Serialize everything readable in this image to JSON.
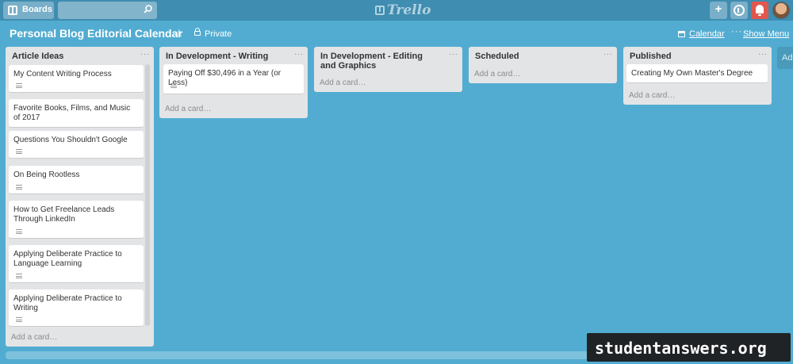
{
  "header": {
    "boards_label": "Boards",
    "search_placeholder": "",
    "logo_text": "Trello",
    "icons": [
      "boards-icon",
      "search-icon",
      "plus-icon",
      "info-icon",
      "bell-icon"
    ]
  },
  "board": {
    "title": "Personal Blog Editorial Calendar",
    "visibility": "Private",
    "calendar_label": "Calendar",
    "show_menu_label": "Show Menu",
    "add_list_label": "Ad"
  },
  "lists": [
    {
      "title": "Article Ideas",
      "add_card": "Add a card…",
      "cards": [
        {
          "title": "My Content Writing Process"
        },
        {
          "title": "Favorite Books, Films, and Music of 2017"
        },
        {
          "title": "Questions You Shouldn't Google"
        },
        {
          "title": "On Being Rootless"
        },
        {
          "title": "How to Get Freelance Leads Through LinkedIn"
        },
        {
          "title": "Applying Deliberate Practice to Language Learning"
        },
        {
          "title": "Applying Deliberate Practice to Writing"
        }
      ]
    },
    {
      "title": "In Development - Writing",
      "add_card": "Add a card…",
      "cards": [
        {
          "title": "Paying Off $30,496 in a Year (or Less)"
        }
      ]
    },
    {
      "title": "In Development - Editing and Graphics",
      "add_card": "Add a card…",
      "cards": []
    },
    {
      "title": "Scheduled",
      "add_card": "Add a card…",
      "cards": []
    },
    {
      "title": "Published",
      "add_card": "Add a card…",
      "cards": [
        {
          "title": "Creating My Own Master's Degree"
        }
      ]
    }
  ],
  "watermark": "studentanswers.org",
  "colors": {
    "board_background": "#52acd1",
    "header_background": "#3f8db0",
    "list_background": "#e2e4e6",
    "notification_red": "#e2574c"
  }
}
